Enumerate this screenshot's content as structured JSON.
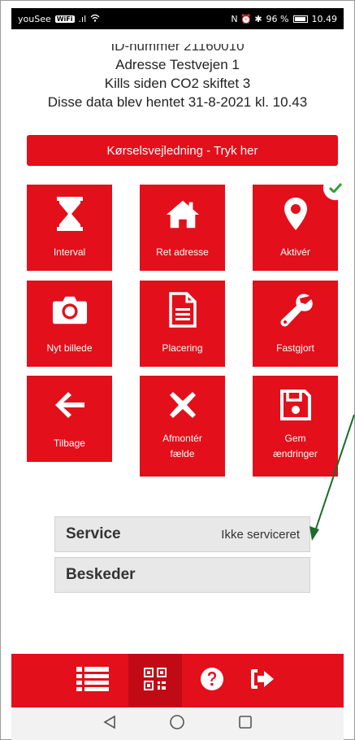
{
  "status_bar": {
    "carrier": "youSee",
    "wifi_badge": "WiFi",
    "signal": ".ıl",
    "right_icons": "N ⏰ ✱",
    "battery_percent": "96 %",
    "time": "10.49"
  },
  "info": {
    "id_line": "ID-nummer 21160010",
    "address": "Adresse Testvejen 1",
    "kills": "Kills siden CO2 skiftet 3",
    "fetched": "Disse data blev hentet 31-8-2021 kl. 10.43"
  },
  "guide_button": "Kørselsvejledning - Tryk her",
  "tiles": {
    "interval": "Interval",
    "ret_adresse": "Ret adresse",
    "aktiver": "Aktivér",
    "nyt_billede": "Nyt billede",
    "placering": "Placering",
    "fastgjort": "Fastgjort",
    "tilbage": "Tilbage",
    "afmonter_1": "Afmontér",
    "afmonter_2": "fælde",
    "gem_1": "Gem",
    "gem_2": "ændringer"
  },
  "panels": {
    "service_title": "Service",
    "service_value": "Ikke serviceret",
    "messages_title": "Beskeder"
  },
  "colors": {
    "brand_red": "#e30f1b",
    "arrow_green": "#1e6b2a",
    "check_green": "#3a9a3a"
  }
}
